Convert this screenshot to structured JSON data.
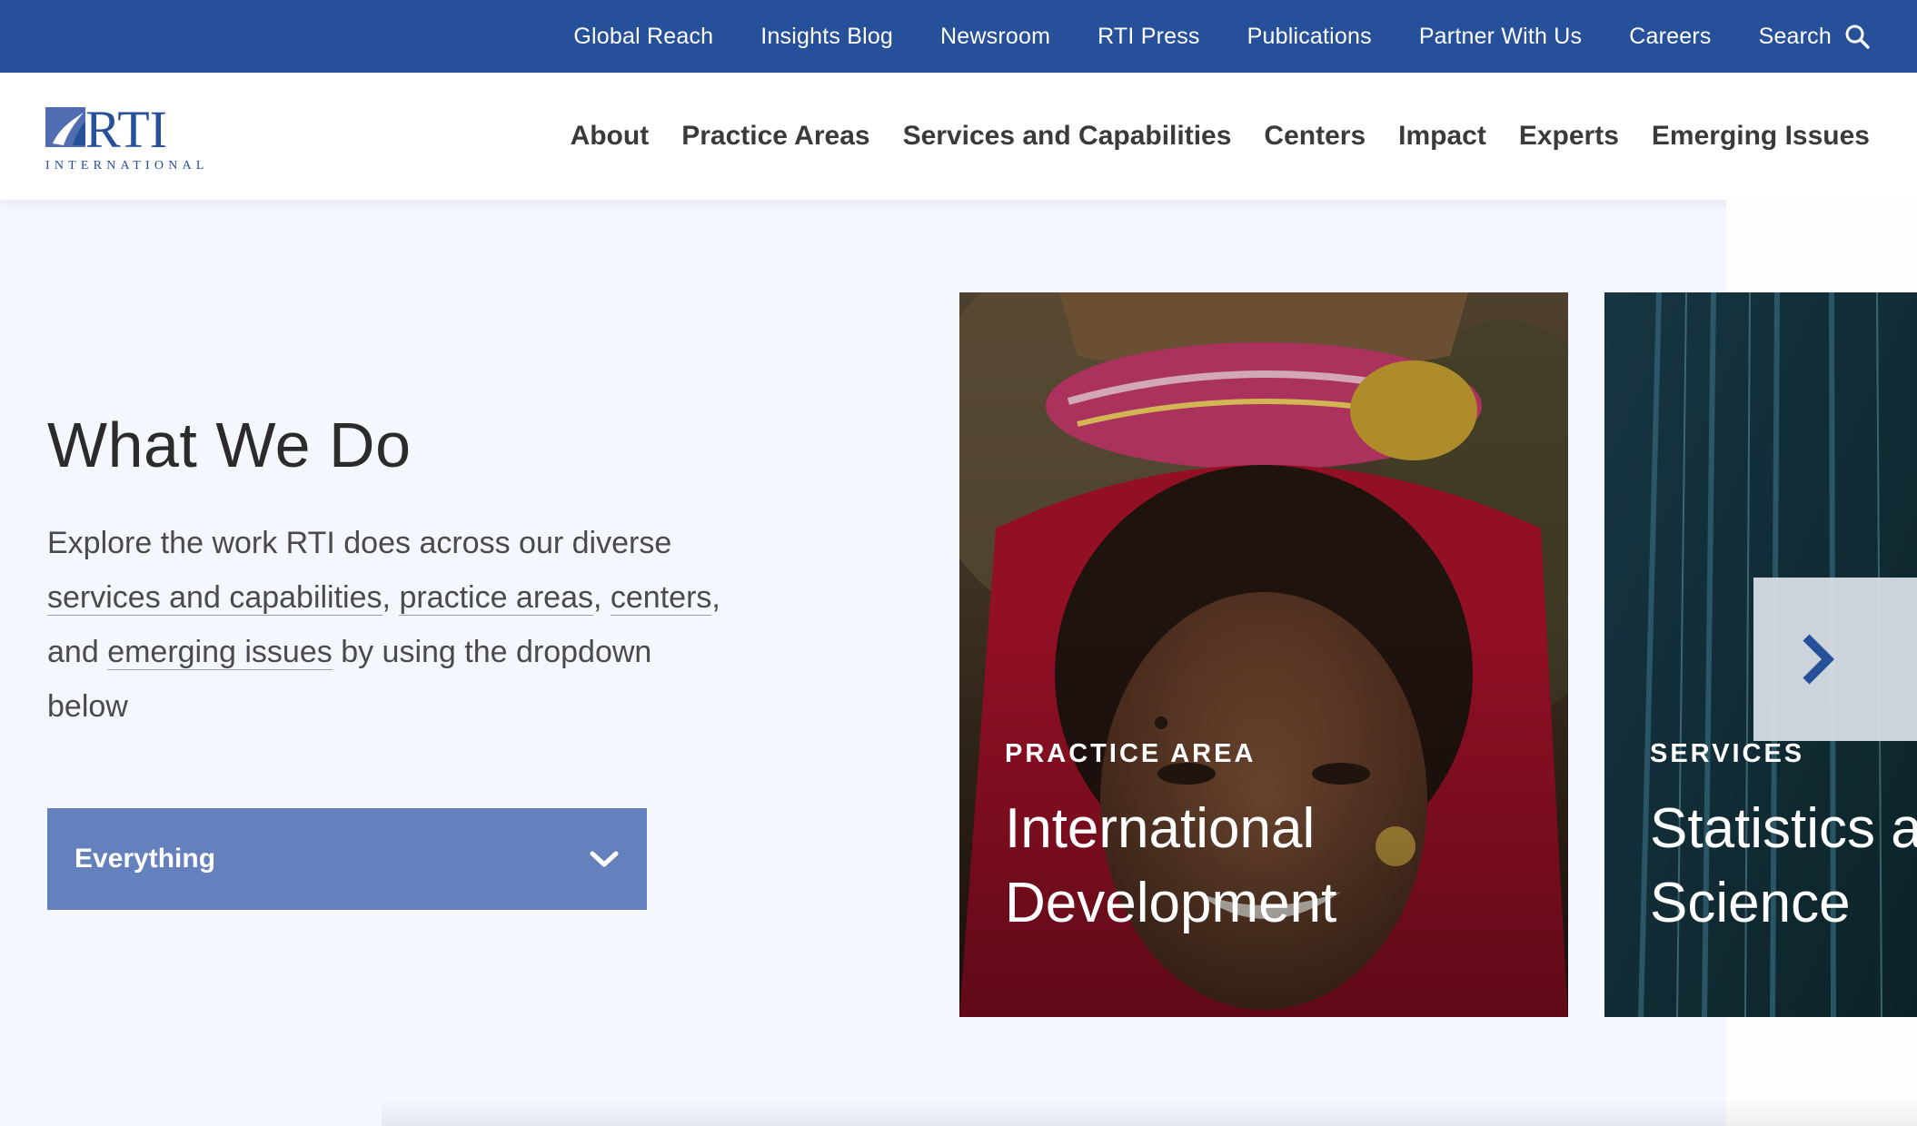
{
  "utility_nav": {
    "items": [
      "Global Reach",
      "Insights Blog",
      "Newsroom",
      "RTI Press",
      "Publications",
      "Partner With Us",
      "Careers"
    ],
    "search_label": "Search",
    "search_icon": "search-icon"
  },
  "logo": {
    "text": "RTI",
    "subtext": "INTERNATIONAL"
  },
  "main_nav": {
    "items": [
      "About",
      "Practice Areas",
      "Services and Capabilities",
      "Centers",
      "Impact",
      "Experts",
      "Emerging Issues"
    ]
  },
  "intro": {
    "heading": "What We Do",
    "text_1": "Explore the work RTI does across our diverse",
    "link_services": "services and capabilities",
    "sep_1": ",",
    "link_practice": "practice areas",
    "sep_2": ",",
    "link_centers": "centers",
    "text_2": ", and",
    "link_emerging": "emerging issues",
    "text_3": "by using the dropdown below"
  },
  "dropdown": {
    "selected": "Everything",
    "icon": "chevron-down-icon"
  },
  "cards": [
    {
      "eyebrow": "PRACTICE AREA",
      "title_line1": "International",
      "title_line2": "Development"
    },
    {
      "eyebrow": "SERVICES",
      "title_line1": "Statistics a",
      "title_line2": "Science"
    }
  ],
  "carousel": {
    "next_icon": "chevron-right-icon"
  },
  "colors": {
    "utility_bg": "#27509a",
    "dropdown_bg": "#6480bd",
    "page_bg": "#f4f7fd",
    "nav_text": "#3a3a3a",
    "accent_arrow": "#27509a"
  }
}
